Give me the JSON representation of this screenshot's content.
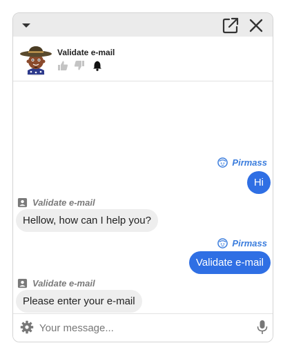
{
  "header": {
    "bot_name": "Validate e-mail"
  },
  "icons": {
    "collapse": "caret-down-icon",
    "popout": "external-link-icon",
    "close": "close-icon",
    "thumbs_up": "thumbs-up-icon",
    "thumbs_down": "thumbs-down-icon",
    "bell": "bell-icon",
    "user": "user-face-icon",
    "bot": "contact-card-icon",
    "settings": "gear-icon",
    "mic": "microphone-icon"
  },
  "messages": [
    {
      "from": "user",
      "sender": "Pirmass",
      "text": "Hi"
    },
    {
      "from": "bot",
      "sender": "Validate e-mail",
      "text": "Hellow, how can I help you?"
    },
    {
      "from": "user",
      "sender": "Pirmass",
      "text": "Validate e-mail"
    },
    {
      "from": "bot",
      "sender": "Validate e-mail",
      "text": "Please enter your e-mail"
    }
  ],
  "composer": {
    "placeholder": "Your message...",
    "value": ""
  },
  "colors": {
    "user_bubble": "#2f6fe4",
    "user_name": "#3b7ddd",
    "bot_bubble": "#eeeeee",
    "bot_name": "#7a7a7a",
    "topbar": "#ebebeb"
  }
}
